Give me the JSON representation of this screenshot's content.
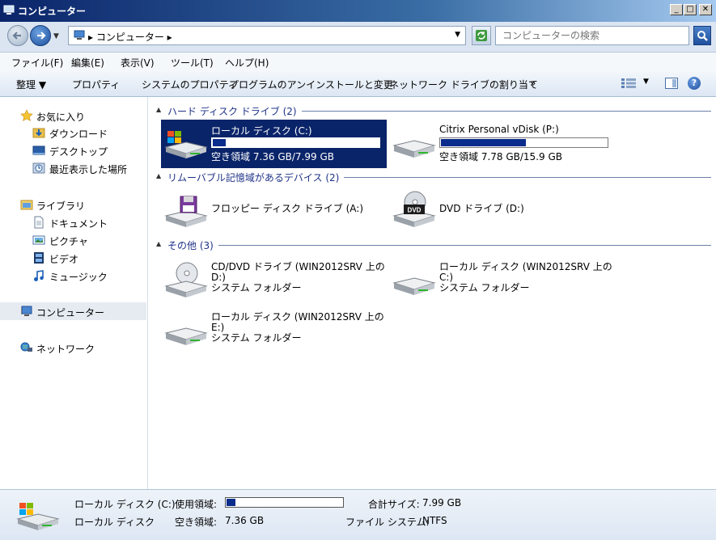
{
  "window": {
    "title": "コンピューター",
    "min": "_",
    "max": "□",
    "close": "✕"
  },
  "address": {
    "crumb": "▸ コンピューター ▸",
    "search_placeholder": "コンピューターの検索"
  },
  "menu": [
    "ファイル(F)",
    "編集(E)",
    "表示(V)",
    "ツール(T)",
    "ヘルプ(H)"
  ],
  "commands": {
    "organize": "整理 ▼",
    "properties": "プロパティ",
    "system_properties": "システムのプロパティ",
    "uninstall": "プログラムのアンインストールと変更",
    "map_drive": "ネットワーク ドライブの割り当て",
    "more": "»"
  },
  "sidebar": {
    "favorites": "お気に入り",
    "downloads": "ダウンロード",
    "desktop": "デスクトップ",
    "recent": "最近表示した場所",
    "libraries": "ライブラリ",
    "documents": "ドキュメント",
    "pictures": "ピクチャ",
    "videos": "ビデオ",
    "music": "ミュージック",
    "computer": "コンピューター",
    "network": "ネットワーク"
  },
  "groups": {
    "hdd": "ハード ディスク ドライブ (2)",
    "removable": "リムーバブル記憶域があるデバイス (2)",
    "other": "その他 (3)"
  },
  "drives": {
    "c": {
      "name": "ローカル ディスク (C:)",
      "free": "空き領域 7.36 GB/7.99 GB",
      "used_fraction": 0.08
    },
    "p": {
      "name": "Citrix Personal vDisk (P:)",
      "free": "空き領域 7.78 GB/15.9 GB",
      "used_fraction": 0.51
    },
    "a": {
      "name": "フロッピー ディスク ドライブ (A:)"
    },
    "d": {
      "name": "DVD ドライブ (D:)",
      "badge": "DVD"
    },
    "rd": {
      "name": "CD/DVD ドライブ (WIN2012SRV 上の\nD:)",
      "sub": "システム フォルダー"
    },
    "rc": {
      "name": "ローカル ディスク (WIN2012SRV 上の\nC:)",
      "sub": "システム フォルダー"
    },
    "re": {
      "name": "ローカル ディスク (WIN2012SRV 上の\nE:)",
      "sub": "システム フォルダー"
    }
  },
  "details": {
    "name": "ローカル ディスク (C:)",
    "type": "ローカル ディスク",
    "used_label": "使用領域:",
    "free_label": "空き領域:",
    "free_value": "7.36 GB",
    "total_label": "合計サイズ:",
    "total_value": "7.99 GB",
    "fs_label": "ファイル システム:",
    "fs_value": "NTFS",
    "used_fraction": 0.08
  }
}
